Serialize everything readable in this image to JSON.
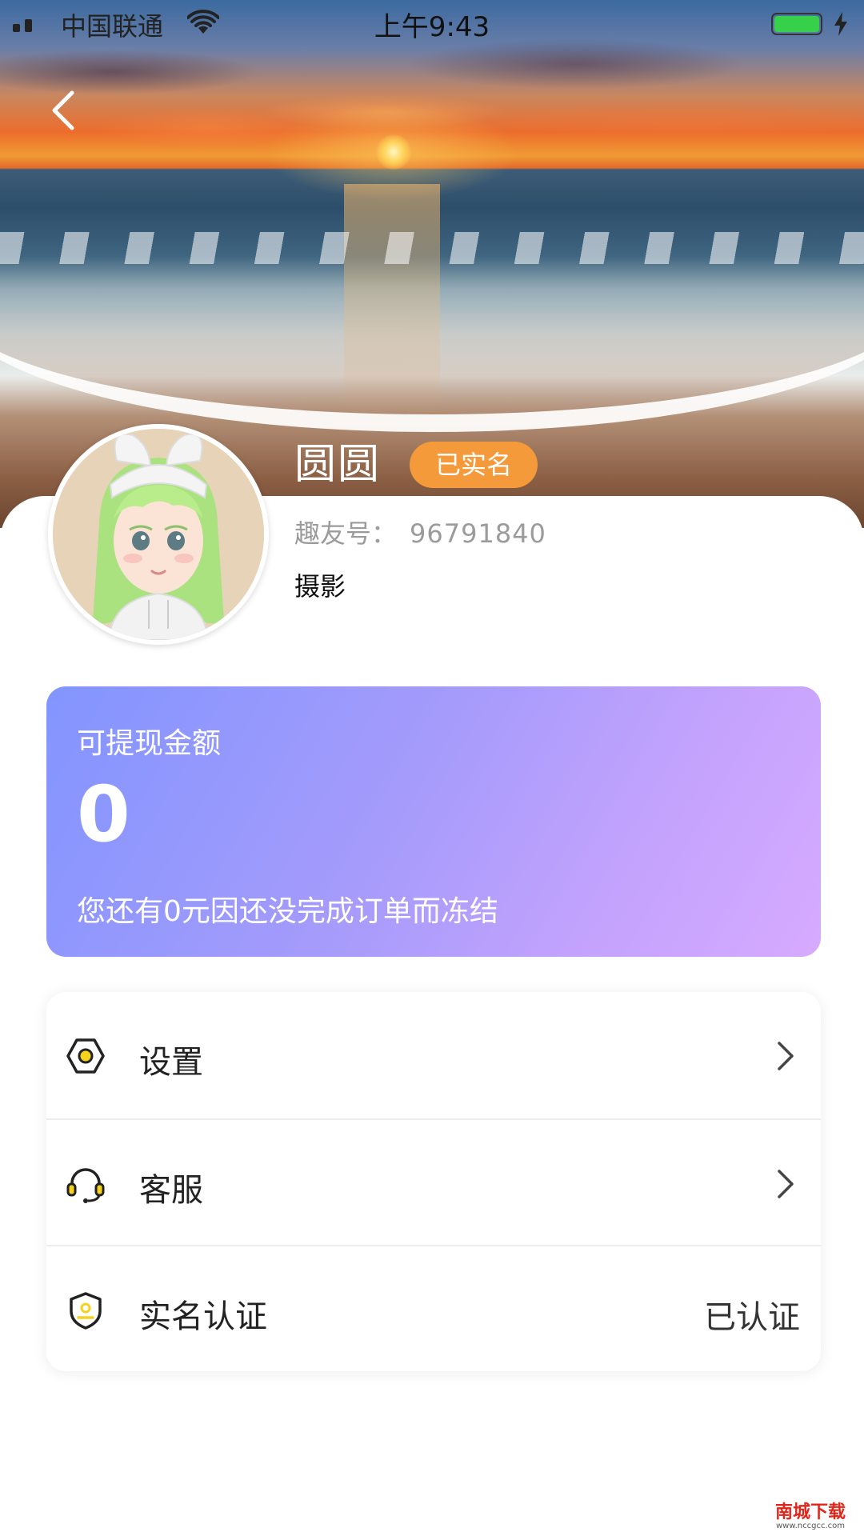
{
  "status_bar": {
    "carrier": "中国联通",
    "time": "上午9:43",
    "battery_color": "#37d04a"
  },
  "nav": {
    "back_icon": "chevron-left-icon"
  },
  "profile": {
    "name": "圆圆",
    "verified_badge": "已实名",
    "badge_color": "#f59a3a",
    "id_label": "趣友号：",
    "id_value": "96791840",
    "interest": "摄影",
    "avatar_icon": "girl-avatar-icon"
  },
  "balance_card": {
    "title": "可提现金额",
    "amount": "0",
    "note": "您还有0元因还没完成订单而冻结",
    "gradient": [
      "#8295ff",
      "#d6aaff"
    ]
  },
  "menu": {
    "items": [
      {
        "label": "设置",
        "icon": "settings-hexagon-icon",
        "accessory": "chevron-right-icon"
      },
      {
        "label": "客服",
        "icon": "headset-icon",
        "accessory": "chevron-right-icon"
      },
      {
        "label": "实名认证",
        "icon": "shield-id-icon",
        "value": "已认证"
      }
    ],
    "icon_accent": "#f6d21c"
  },
  "watermark": {
    "title": "南城下载",
    "site": "www.nccgcc.com"
  }
}
